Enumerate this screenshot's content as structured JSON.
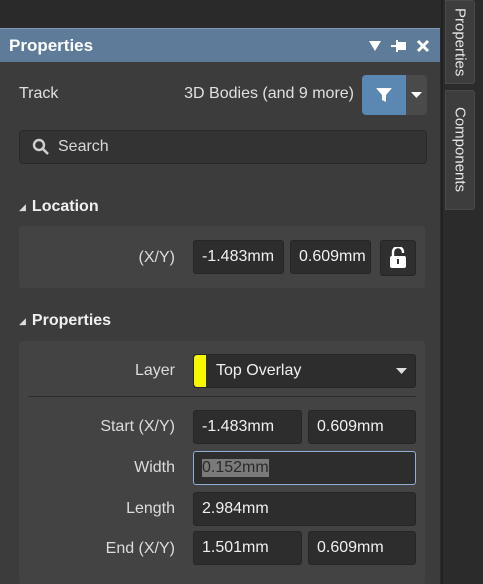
{
  "panel": {
    "title": "Properties"
  },
  "header": {
    "object_type": "Track",
    "filter_summary": "3D Bodies (and 9 more)"
  },
  "search": {
    "placeholder": "Search"
  },
  "location": {
    "heading": "Location",
    "xy_label": "(X/Y)",
    "x": "-1.483mm",
    "y": "0.609mm"
  },
  "properties": {
    "heading": "Properties",
    "layer_label": "Layer",
    "layer_value": "Top Overlay",
    "layer_color": "#f7f700",
    "start_label": "Start (X/Y)",
    "start_x": "-1.483mm",
    "start_y": "0.609mm",
    "width_label": "Width",
    "width_value": "0.152mm",
    "length_label": "Length",
    "length_value": "2.984mm",
    "end_label": "End (X/Y)",
    "end_x": "1.501mm",
    "end_y": "0.609mm"
  },
  "side_tabs": {
    "properties": "Properties",
    "components": "Components"
  },
  "colors": {
    "titlebar": "#5e7b9a",
    "filter_accent": "#5b87b3",
    "panel_bg": "#3c3c3c"
  }
}
